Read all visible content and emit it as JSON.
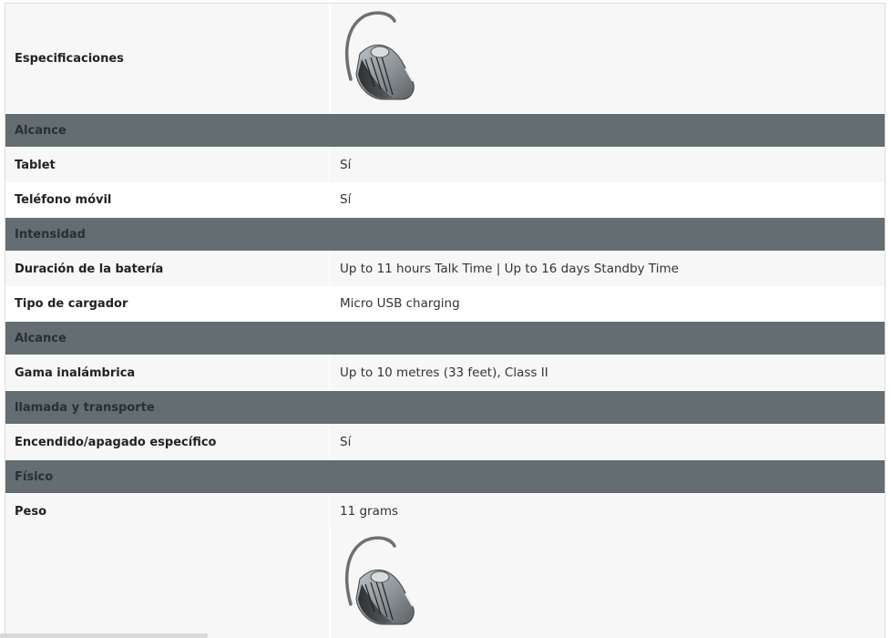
{
  "spec_label": "Especificaciones",
  "rows": [
    {
      "type": "header",
      "label": "Alcance"
    },
    {
      "type": "data",
      "label": "Tablet",
      "value": "Sí"
    },
    {
      "type": "data",
      "label": "Teléfono móvil",
      "value": "Sí"
    },
    {
      "type": "header",
      "label": "Intensidad"
    },
    {
      "type": "data",
      "label": "Duración de la batería",
      "value": "Up to 11 hours Talk Time | Up to 16 days Standby Time"
    },
    {
      "type": "data",
      "label": "Tipo de cargador",
      "value": "Micro USB charging"
    },
    {
      "type": "header",
      "label": "Alcance"
    },
    {
      "type": "data",
      "label": "Gama inalámbrica",
      "value": "Up to 10 metres (33 feet), Class II"
    },
    {
      "type": "header",
      "label": "llamada y transporte"
    },
    {
      "type": "data",
      "label": "Encendido/apagado específico",
      "value": "Sí"
    },
    {
      "type": "header",
      "label": "Físico"
    },
    {
      "type": "data",
      "label": "Peso",
      "value": "11 grams"
    }
  ],
  "icons": {
    "product_image": "headset-product-image"
  },
  "colors": {
    "section_header_bg": "#636d72",
    "row_alt_bg": "#f7f7f7"
  }
}
